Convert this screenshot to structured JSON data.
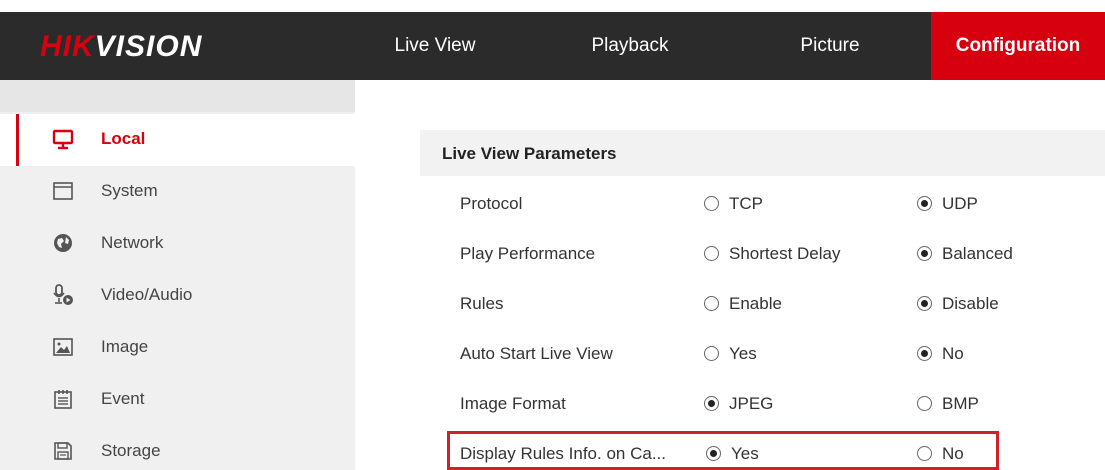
{
  "brand": {
    "hik": "HIK",
    "vision": "VISION"
  },
  "nav": [
    {
      "label": "Live View",
      "active": false
    },
    {
      "label": "Playback",
      "active": false
    },
    {
      "label": "Picture",
      "active": false
    },
    {
      "label": "Configuration",
      "active": true
    }
  ],
  "sidebar": {
    "items": [
      {
        "label": "Local",
        "icon": "monitor-icon",
        "active": true
      },
      {
        "label": "System",
        "icon": "system-window-icon",
        "active": false
      },
      {
        "label": "Network",
        "icon": "globe-icon",
        "active": false
      },
      {
        "label": "Video/Audio",
        "icon": "microphone-camera-icon",
        "active": false
      },
      {
        "label": "Image",
        "icon": "image-icon",
        "active": false
      },
      {
        "label": "Event",
        "icon": "calendar-icon",
        "active": false
      },
      {
        "label": "Storage",
        "icon": "save-disk-icon",
        "active": false
      }
    ]
  },
  "section": {
    "title": "Live View Parameters"
  },
  "params": [
    {
      "label": "Protocol",
      "options": [
        "TCP",
        "UDP"
      ],
      "selected": 1
    },
    {
      "label": "Play Performance",
      "options": [
        "Shortest Delay",
        "Balanced"
      ],
      "selected": 1
    },
    {
      "label": "Rules",
      "options": [
        "Enable",
        "Disable"
      ],
      "selected": 1
    },
    {
      "label": "Auto Start Live View",
      "options": [
        "Yes",
        "No"
      ],
      "selected": 1
    },
    {
      "label": "Image Format",
      "options": [
        "JPEG",
        "BMP"
      ],
      "selected": 0
    },
    {
      "label": "Display Rules Info. on Ca...",
      "options": [
        "Yes",
        "No"
      ],
      "selected": 0,
      "highlighted": true
    }
  ],
  "colors": {
    "brand_red": "#d7000f",
    "topbar": "#2b2b2b",
    "highlight": "#d0212a"
  }
}
